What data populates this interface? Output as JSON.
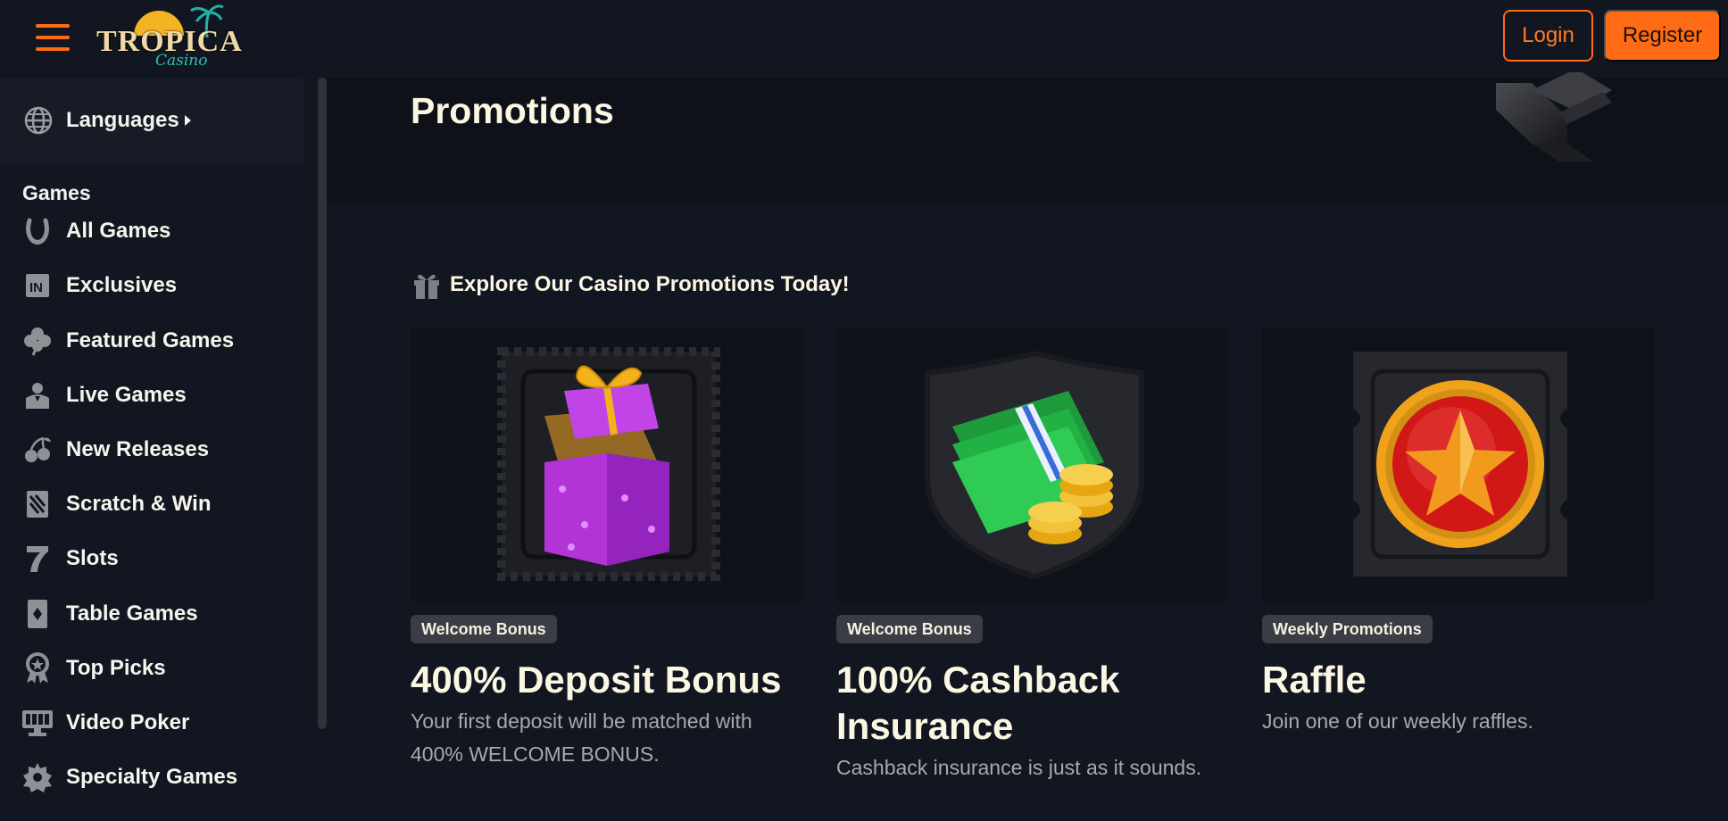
{
  "header": {
    "logo_text": "TROPICA",
    "logo_subtext": "Casino",
    "login_label": "Login",
    "register_label": "Register"
  },
  "sidebar": {
    "languages_label": "Languages",
    "games_heading": "Games",
    "items": [
      {
        "label": "All Games",
        "icon": "horseshoe-icon"
      },
      {
        "label": "Exclusives",
        "icon": "exclusive-icon"
      },
      {
        "label": "Featured Games",
        "icon": "clover-icon"
      },
      {
        "label": "Live Games",
        "icon": "dealer-icon"
      },
      {
        "label": "New Releases",
        "icon": "cherries-icon"
      },
      {
        "label": "Scratch & Win",
        "icon": "scratch-ticket-icon"
      },
      {
        "label": "Slots",
        "icon": "seven-icon"
      },
      {
        "label": "Table Games",
        "icon": "playing-card-icon"
      },
      {
        "label": "Top Picks",
        "icon": "award-icon"
      },
      {
        "label": "Video Poker",
        "icon": "video-poker-icon"
      },
      {
        "label": "Specialty Games",
        "icon": "specialty-gear-icon"
      }
    ]
  },
  "main": {
    "page_title": "Promotions",
    "section_heading": "Explore Our Casino Promotions Today!",
    "cards": [
      {
        "badge": "Welcome Bonus",
        "title": "400% Deposit Bonus",
        "description": "Your first deposit will be matched with 400% WELCOME BONUS.",
        "image": "gift-box-icon"
      },
      {
        "badge": "Welcome Bonus",
        "title": "100% Cashback Insurance",
        "description": "Cashback insurance is just as it sounds.",
        "image": "cash-and-coins-icon"
      },
      {
        "badge": "Weekly Promotions",
        "title": "Raffle",
        "description": "Join one of our weekly raffles.",
        "image": "star-token-icon"
      }
    ]
  },
  "colors": {
    "accent": "#ff6a14",
    "background": "#121620",
    "hero_background": "#0e1119",
    "badge_background": "#3b3d44",
    "text": "#fbf7e3",
    "muted_text": "#a7a9ad"
  }
}
